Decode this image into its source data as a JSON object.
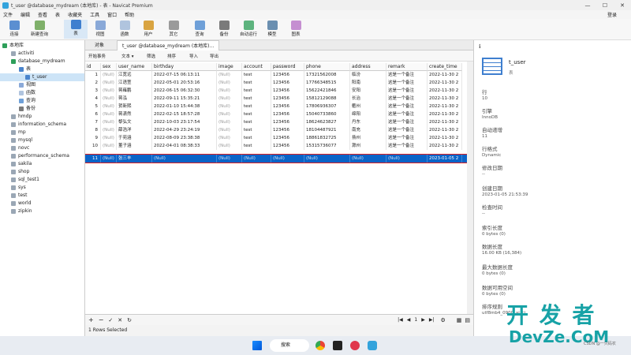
{
  "window": {
    "title": "t_user @database_mydream (本地库) - 表 - Navicat Premium",
    "controls": [
      "—",
      "☐",
      "✕"
    ]
  },
  "menu": {
    "items": [
      "文件",
      "编辑",
      "查看",
      "表",
      "收藏夹",
      "工具",
      "窗口",
      "帮助"
    ],
    "login": "登录"
  },
  "toolbar": {
    "items": [
      "连接",
      "新建查询",
      "表",
      "视图",
      "函数",
      "用户",
      "其它",
      "查询",
      "备份",
      "自动运行",
      "模型",
      "图表"
    ]
  },
  "tree": [
    {
      "label": "本地库"
    },
    {
      "label": "activiti"
    },
    {
      "label": "database_mydream"
    },
    {
      "label": "表"
    },
    {
      "label": "t_user"
    },
    {
      "label": "视图"
    },
    {
      "label": "函数"
    },
    {
      "label": "查询"
    },
    {
      "label": "备份"
    },
    {
      "label": "hmdp"
    },
    {
      "label": "information_schema"
    },
    {
      "label": "mp"
    },
    {
      "label": "mysql"
    },
    {
      "label": "novc"
    },
    {
      "label": "performance_schema"
    },
    {
      "label": "sakila"
    },
    {
      "label": "shop"
    },
    {
      "label": "sql_test1"
    },
    {
      "label": "sys"
    },
    {
      "label": "test"
    },
    {
      "label": "world"
    },
    {
      "label": "zipkin"
    }
  ],
  "tabs": [
    "对象",
    "t_user @database_mydream (本地库)..."
  ],
  "subtoolbar": [
    "开始事务",
    "文本 ▾",
    "筛选",
    "排序",
    "导入",
    "导出"
  ],
  "grid": {
    "columns": [
      "id",
      "sex",
      "user_name",
      "birthday",
      "image",
      "account",
      "password",
      "phone",
      "address",
      "remark",
      "create_time"
    ],
    "rows": [
      [
        "1",
        "(Null)",
        "江宽远",
        "2022-07-15 06:13:11",
        "(Null)",
        "test",
        "123456",
        "17321562008",
        "临汾",
        "这是一个备注",
        "2022-11-30 2"
      ],
      [
        "2",
        "(Null)",
        "江语萱",
        "2022-05-01 20:53:16",
        "(Null)",
        "test",
        "123456",
        "17766348515",
        "阳南",
        "这是一个备注",
        "2022-11-30 2"
      ],
      [
        "3",
        "(Null)",
        "蒋雍鹏",
        "2022-06-15 06:32:30",
        "(Null)",
        "test",
        "123456",
        "15622421846",
        "安阳",
        "这是一个备注",
        "2022-11-30 2"
      ],
      [
        "4",
        "(Null)",
        "蒋泓",
        "2022-09-11 15:35:21",
        "(Null)",
        "test",
        "123456",
        "15812129088",
        "长治",
        "这是一个备注",
        "2022-11-30 2"
      ],
      [
        "5",
        "(Null)",
        "贺新熙",
        "2022-01-10 15:44:38",
        "(Null)",
        "test",
        "123456",
        "17806936307",
        "衢州",
        "这是一个备注",
        "2022-11-30 2"
      ],
      [
        "6",
        "(Null)",
        "蒋潇然",
        "2022-02-15 18:57:28",
        "(Null)",
        "test",
        "123456",
        "15040733860",
        "绵阳",
        "这是一个备注",
        "2022-11-30 2"
      ],
      [
        "7",
        "(Null)",
        "黎弘文",
        "2022-10-03 23:17:54",
        "(Null)",
        "test",
        "123456",
        "18624623827",
        "丹东",
        "这是一个备注",
        "2022-11-30 2"
      ],
      [
        "8",
        "(Null)",
        "薛浩洋",
        "2022-04-29 23:24:19",
        "(Null)",
        "test",
        "123456",
        "18104487921",
        "南充",
        "这是一个备注",
        "2022-11-30 2"
      ],
      [
        "9",
        "(Null)",
        "于苑涵",
        "2022-08-09 23:38:38",
        "(Null)",
        "test",
        "123456",
        "18861832725",
        "扬州",
        "这是一个备注",
        "2022-11-30 2"
      ],
      [
        "10",
        "(Null)",
        "董子涵",
        "2022-04-01 08:38:33",
        "(Null)",
        "test",
        "123456",
        "15315736077",
        "滁州",
        "这是一个备注",
        "2022-11-30 2"
      ]
    ],
    "new_row": [
      "11",
      "(Null)",
      "张三丰",
      "(Null)",
      "(Null)",
      "(Null)",
      "(Null)",
      "(Null)",
      "(Null)",
      "(Null)",
      "2023-01-05 2"
    ]
  },
  "footer": {
    "page": "1",
    "status": "1 Rows Selected"
  },
  "info": {
    "table_name": "t_user",
    "table_kind": "表",
    "fields": [
      {
        "label": "行",
        "value": "10"
      },
      {
        "label": "引擎",
        "value": "InnoDB"
      },
      {
        "label": "自动递增",
        "value": "11"
      },
      {
        "label": "行格式",
        "value": "Dynamic"
      },
      {
        "label": "修改日期",
        "value": "--"
      },
      {
        "label": "创建日期",
        "value": "2023-01-05 21:53:39"
      },
      {
        "label": "检查时间",
        "value": "--"
      },
      {
        "label": "索引长度",
        "value": "0 bytes (0)"
      },
      {
        "label": "数据长度",
        "value": "16.00 KB (16,384)"
      },
      {
        "label": "最大数据长度",
        "value": "0 bytes (0)"
      },
      {
        "label": "数据可用空间",
        "value": "0 bytes (0)"
      },
      {
        "label": "排序规则",
        "value": "utf8mb4_0900_ai_ci"
      }
    ]
  },
  "taskbar": {
    "search_label": "搜索"
  },
  "watermark": {
    "big": "开 发 者",
    "small": "DevZe.CoM",
    "csdn": "CSDN @一只码农"
  }
}
